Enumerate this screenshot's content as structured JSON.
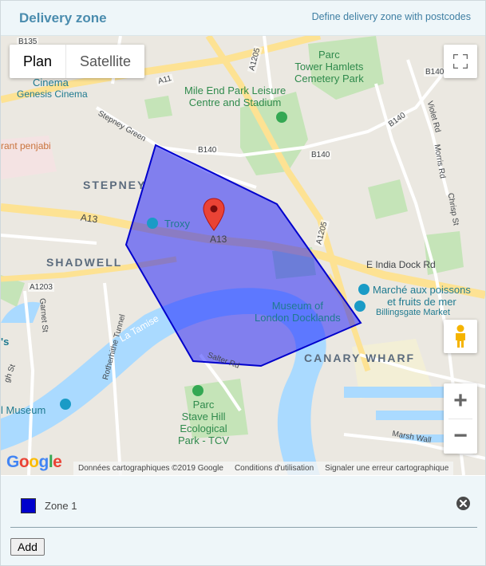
{
  "header": {
    "title": "Delivery zone",
    "define_link": "Define delivery zone with postcodes"
  },
  "map": {
    "type_control": {
      "plan": "Plan",
      "satellite": "Satellite",
      "selected": "Plan"
    },
    "labels": {
      "parc_tower_hamlets": "Parc\nTower Hamlets\nCemetery Park",
      "mile_end": "Mile End Park Leisure\nCentre and Stadium",
      "cinema": "Cinema",
      "genesis": "Genesis Cinema",
      "stepney_green": "Stepney Green",
      "restaurant": "rant penjabi",
      "stepney": "STEPNEY",
      "troxy": "Troxy",
      "shadwell": "SHADWELL",
      "a13_left": "A13",
      "a13_center": "A13",
      "e_india_dock": "E India Dock Rd",
      "marche": "Marché aux poissons\net fruits de mer",
      "billingsgate": "Billingsgate Market",
      "museum": "Museum of\nLondon Docklands",
      "canary": "CANARY WHARF",
      "la_tamise": "La Tamise",
      "rotherhithe": "Rotherhithe Tunnel",
      "salter": "Salter Rd",
      "parc_stave": "Parc\nStave Hill\nEcological\nPark - TCV",
      "l_museum": "l Museum",
      "marsh_wall": "Marsh Wall",
      "a11": "A11",
      "a1205_top": "A1205",
      "a1205_mid": "A1205",
      "b140_top": "B140",
      "b140_mid": "B140",
      "b140_right": "B140",
      "b140_far": "B140",
      "b135": "B135",
      "a1203": "A1203",
      "violet": "Violet Rd",
      "morris": "Morris Rd",
      "chrisp": "Chrisp St",
      "garnet": "Garnet St",
      "gh_st": "gh St",
      "s_left": "'s"
    },
    "google_logo": "Google",
    "attribution": {
      "data": "Données cartographiques ©2019 Google",
      "terms": "Conditions d'utilisation",
      "report": "Signaler une erreur cartographique"
    },
    "zoom_in": "+",
    "zoom_out": "−",
    "zone_color": "#0000ff"
  },
  "zones": [
    {
      "name": "Zone 1",
      "color": "#0000cc"
    }
  ],
  "add_button": "Add"
}
